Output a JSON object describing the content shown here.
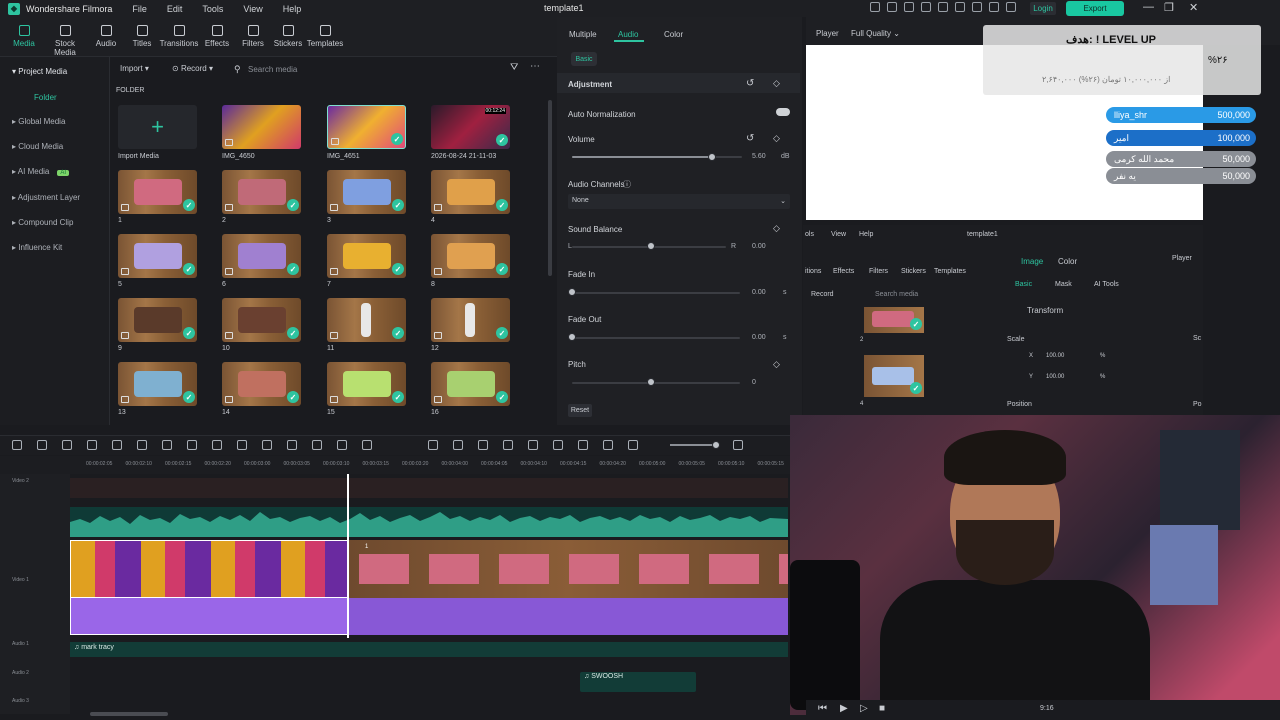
{
  "titlebar": {
    "app": "Wondershare Filmora",
    "menus": [
      "File",
      "Edit",
      "Tools",
      "View",
      "Help"
    ],
    "doc": "template1",
    "login": "Login",
    "export": "Export"
  },
  "toolbar": {
    "items": [
      "Media",
      "Stock Media",
      "Audio",
      "Titles",
      "Transitions",
      "Effects",
      "Filters",
      "Stickers",
      "Templates"
    ]
  },
  "sidebar": {
    "items": [
      "Project Media",
      "Folder",
      "Global Media",
      "Cloud Media",
      "AI Media",
      "Adjustment Layer",
      "Compound Clip",
      "Influence Kit"
    ],
    "ai_badge": "AI"
  },
  "media": {
    "import_label": "Import",
    "record_label": "Record",
    "search_placeholder": "Search media",
    "folder": "FOLDER",
    "top": [
      "Import Media",
      "IMG_4650",
      "IMG_4651",
      "2026-08-24 21-11-03"
    ],
    "duration": "00:12:24",
    "grid": [
      "1",
      "2",
      "3",
      "4",
      "5",
      "6",
      "7",
      "8",
      "9",
      "10",
      "11",
      "12",
      "13",
      "14",
      "15",
      "16"
    ]
  },
  "props": {
    "tabs": [
      "Multiple",
      "Audio",
      "Color"
    ],
    "subtab": "Basic",
    "section": "Adjustment",
    "auto_norm": "Auto Normalization",
    "volume": "Volume",
    "volume_val": "5.60",
    "volume_unit": "dB",
    "audio_channels": "Audio Channels",
    "channels_val": "None",
    "sound_balance": "Sound Balance",
    "bal_l": "L",
    "bal_r": "R",
    "bal_val": "0.00",
    "fade_in": "Fade In",
    "fade_in_val": "0.00",
    "fade_out": "Fade Out",
    "fade_out_val": "0.00",
    "unit_s": "s",
    "pitch": "Pitch",
    "pitch_val": "0",
    "reset": "Reset"
  },
  "player": {
    "label": "Player",
    "quality": "Full Quality"
  },
  "overlay": {
    "title": "هدف: ! LEVEL UP",
    "percent": "%۲۶",
    "sub": "۲,۶۴۰,۰۰۰ از ۱۰,۰۰۰,۰۰۰ تومان (۲۶%)",
    "donors": [
      {
        "name": "lliya_shr",
        "amount": "500,000",
        "color": "#2a9ae6"
      },
      {
        "name": "امیر",
        "amount": "100,000",
        "color": "#1c6fc8"
      },
      {
        "name": "محمد الله کرمی",
        "amount": "50,000",
        "color": "#8a8e95"
      },
      {
        "name": "یه نفر",
        "amount": "50,000",
        "color": "#8a8e95"
      }
    ]
  },
  "inner": {
    "menus": [
      "ols",
      "View",
      "Help"
    ],
    "doc": "template1",
    "tools": [
      "itions",
      "Effects",
      "Filters",
      "Stickers",
      "Templates"
    ],
    "tabs": [
      "Image",
      "Color"
    ],
    "player": "Player",
    "subtabs": [
      "Basic",
      "Mask",
      "AI Tools"
    ],
    "record": "Record",
    "search": "Search media",
    "transform": "Transform",
    "scale": "Scale",
    "x": "X",
    "y": "Y",
    "x_val": "100.00",
    "y_val": "100.00",
    "pct": "%",
    "position": "Position",
    "pos": "Po",
    "sc": "Sc",
    "clips": [
      "2",
      "4"
    ]
  },
  "timeline": {
    "ticks": [
      "00:00:02:05",
      "00:00:02:10",
      "00:00:02:15",
      "00:00:02:20",
      "00:00:03:00",
      "00:00:03:05",
      "00:00:03:10",
      "00:00:03:15",
      "00:00:03:20",
      "00:00:04:00",
      "00:00:04:05",
      "00:00:04:10",
      "00:00:04:15",
      "00:00:04:20",
      "00:00:05:00",
      "00:00:05:05",
      "00:00:05:10",
      "00:00:05:15"
    ],
    "tracks": [
      "Video 2",
      "Video 1",
      "Audio 1",
      "Audio 2",
      "Audio 3"
    ],
    "clip1_label": "1",
    "audio1": "mark tracy",
    "audio2": "SWOOSH"
  },
  "bottom": {
    "time": "9:16"
  }
}
